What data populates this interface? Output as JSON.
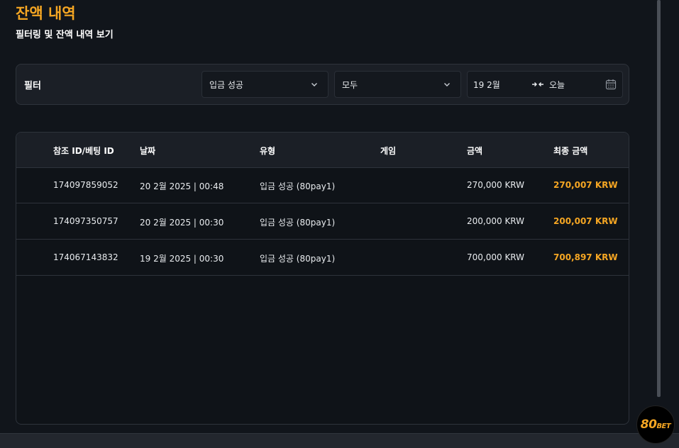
{
  "page": {
    "title": "잔액 내역",
    "subtitle": "필터링 및 잔액 내역 보기"
  },
  "filter": {
    "label": "필터",
    "status_value": "입금 성공",
    "type_value": "모두",
    "date_start": "19 2월",
    "date_end": "오늘"
  },
  "table": {
    "headers": [
      "참조 ID/베팅 ID",
      "날짜",
      "유형",
      "게임",
      "금액",
      "최종 금액"
    ],
    "rows": [
      [
        "174097859052",
        "20 2월 2025 | 00:48",
        "입금 성공 (80pay1)",
        "",
        "270,000 KRW",
        "270,007 KRW"
      ],
      [
        "174097350757",
        "20 2월 2025 | 00:30",
        "입금 성공 (80pay1)",
        "",
        "200,000 KRW",
        "200,007 KRW"
      ],
      [
        "174067143832",
        "19 2월 2025 | 00:30",
        "입금 성공 (80pay1)",
        "",
        "700,000 KRW",
        "700,897 KRW"
      ]
    ]
  },
  "brand": {
    "logo_main": "80",
    "logo_sub": "BET",
    "accent": "#f5a623"
  },
  "icons": {
    "select_chevron": "chevron-down-icon",
    "range": "arrows-in-icon",
    "calendar": "calendar-icon"
  }
}
